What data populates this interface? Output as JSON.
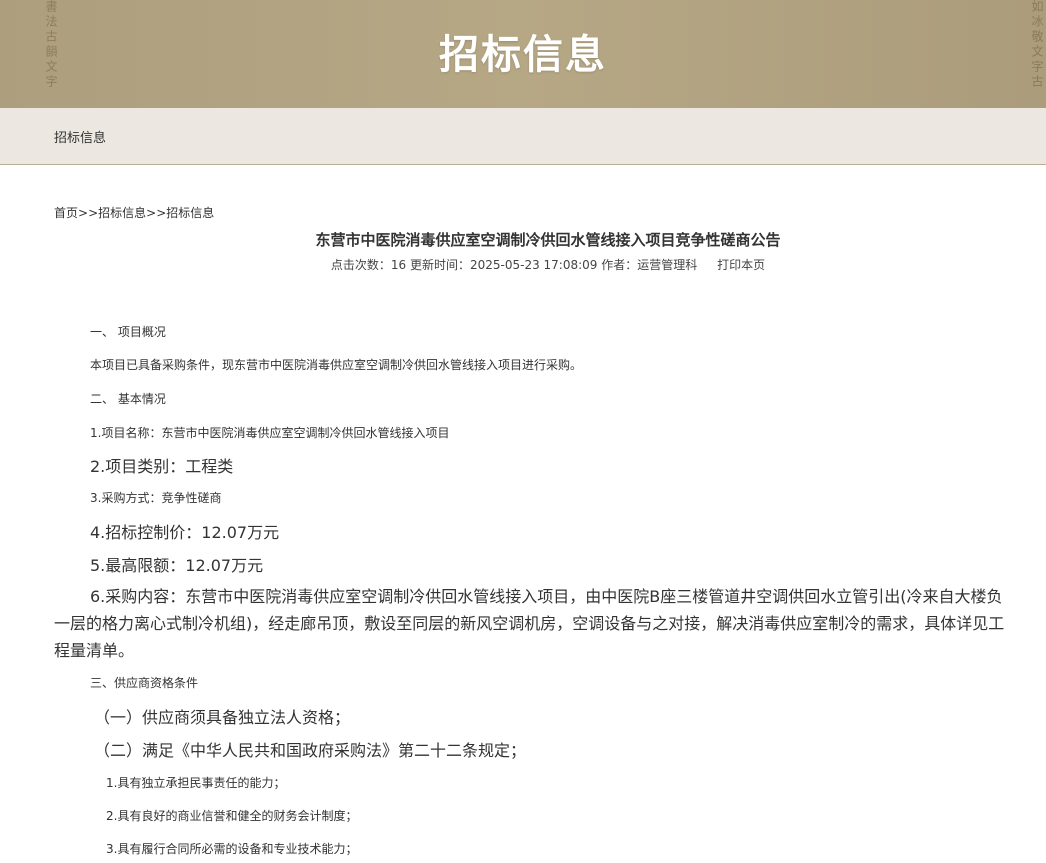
{
  "banner": {
    "title": "招标信息",
    "deco_left": "書法古韻文字",
    "deco_right": "如冰敬文字古"
  },
  "subbar": {
    "title": "招标信息"
  },
  "breadcrumb": {
    "home": "首页",
    "sep1": ">>",
    "level1": "招标信息",
    "sep2": ">>",
    "level2": "招标信息"
  },
  "article": {
    "title": "东营市中医院消毒供应室空调制冷供回水管线接入项目竞争性磋商公告",
    "meta": {
      "clicks": "点击次数：16",
      "updated": "更新时间：2025-05-23 17:08:09",
      "author": "作者：运营管理科",
      "print": "打印本页"
    },
    "paragraphs": [
      "一、 项目概况",
      "本项目已具备采购条件，现东营市中医院消毒供应室空调制冷供回水管线接入项目进行采购。",
      "二、 基本情况",
      "1.项目名称：东营市中医院消毒供应室空调制冷供回水管线接入项目",
      "2.项目类别：工程类",
      "3.采购方式：竞争性磋商",
      "4.招标控制价：12.07万元",
      "5.最高限额：12.07万元",
      "6.采购内容：东营市中医院消毒供应室空调制冷供回水管线接入项目，由中医院B座三楼管道井空调供回水立管引出(冷来自大楼负一层的格力离心式制冷机组)，经走廊吊顶，敷设至同层的新风空调机房，空调设备与之对接，解决消毒供应室制冷的需求，具体详见工程量清单。",
      "三、供应商资格条件",
      "（一）供应商须具备独立法人资格；",
      "（二）满足《中华人民共和国政府采购法》第二十二条规定；",
      "1.具有独立承担民事责任的能力；",
      "2.具有良好的商业信誉和健全的财务会计制度；",
      "3.具有履行合同所必需的设备和专业技术能力；"
    ]
  }
}
